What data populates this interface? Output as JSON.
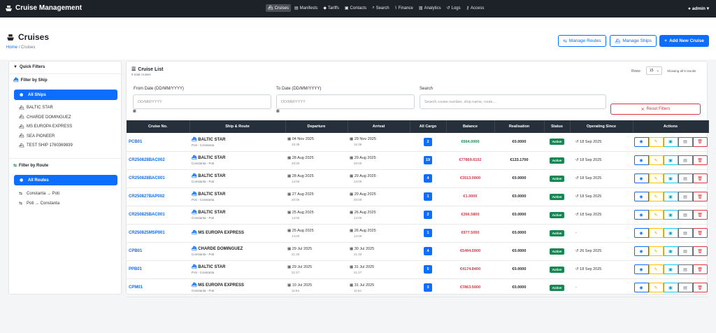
{
  "app": {
    "title": "Cruise Management",
    "user": "admin"
  },
  "nav": [
    {
      "label": "Cruises",
      "icon": "ship-icon",
      "active": true
    },
    {
      "label": "Manifests",
      "icon": "file-icon"
    },
    {
      "label": "Tariffs",
      "icon": "tags-icon"
    },
    {
      "label": "Contacts",
      "icon": "contacts-icon"
    },
    {
      "label": "Search",
      "icon": "search-icon"
    },
    {
      "label": "Finance",
      "icon": "chart-icon"
    },
    {
      "label": "Analytics",
      "icon": "bar-chart-icon"
    },
    {
      "label": "Logs",
      "icon": "history-icon"
    },
    {
      "label": "Access",
      "icon": "key-icon"
    }
  ],
  "page": {
    "title": "Cruises",
    "breadcrumb_home": "Home",
    "breadcrumb_sep": "/",
    "breadcrumb_current": "Cruises",
    "btn_routes": "Manage Routes",
    "btn_ships": "Manage Ships",
    "btn_new": "Add New Cruise"
  },
  "sidebar": {
    "title": "Quick Filters",
    "ship_title": "Filter by Ship",
    "ships": [
      "All Ships",
      "BALTIC STAR",
      "CHARDE DOMINGUEZ",
      "MS EUROPA EXPRESS",
      "SEA PIONEER",
      "TEST SHIP 1760369839"
    ],
    "route_title": "Filter by Route",
    "routes": [
      "All Routes",
      "Constanta → Poti",
      "Poti → Constanta"
    ]
  },
  "list": {
    "title": "Cruise List",
    "subtitle": "9 total cruises",
    "rows_label": "Rows:",
    "rows_value": "15",
    "showing": "Showing all 9 results",
    "from_label": "From Date (DD/MM/YYYY)",
    "from_placeholder": "DD/MM/YYYY",
    "to_label": "To Date (DD/MM/YYYY)",
    "to_placeholder": "DD/MM/YYYY",
    "search_label": "Search",
    "search_placeholder": "Search cruise number, ship name, route...",
    "reset": "Reset Filters",
    "columns": [
      "Cruise No.",
      "Ship & Route",
      "Departure",
      "Arrival",
      "All Cargo",
      "Balance",
      "Realisation",
      "Status",
      "Operating Since",
      "Actions"
    ],
    "rows": [
      {
        "no": "PCB01",
        "ship": "BALTIC STAR",
        "route": "Poti - Constanta",
        "dep_date": "04 Nov 2025",
        "dep_time": "15:38",
        "arr_date": "29 Nov 2025",
        "arr_time": "15:38",
        "cargo": "2",
        "balance": "€664.0000",
        "bal_pos": true,
        "realisation": "€0.0000",
        "status": "Active",
        "since": "18 Sep 2025"
      },
      {
        "no": "CR250828BAC002",
        "ship": "BALTIC STAR",
        "route": "Constanta - Poti",
        "dep_date": "28 Aug 2025",
        "dep_time": "20:00",
        "arr_date": "29 Aug 2025",
        "arr_time": "20:00",
        "cargo": "19",
        "balance": "€77869.6102",
        "bal_pos": false,
        "realisation": "€133.1700",
        "status": "Active",
        "since": "18 Sep 2025"
      },
      {
        "no": "CR250828BAC001",
        "ship": "BALTIC STAR",
        "route": "Constanta - Poti",
        "dep_date": "28 Aug 2025",
        "dep_time": "14:00",
        "arr_date": "29 Aug 2025",
        "arr_time": "14:00",
        "cargo": "4",
        "balance": "€3513.0000",
        "bal_pos": false,
        "realisation": "€0.0000",
        "status": "Active",
        "since": "18 Sep 2025"
      },
      {
        "no": "CR250827BAP002",
        "ship": "BALTIC STAR",
        "route": "Poti - Constanta",
        "dep_date": "27 Aug 2025",
        "dep_time": "20:00",
        "arr_date": "29 Aug 2025",
        "arr_time": "20:00",
        "cargo": "1",
        "balance": "€1.0000",
        "bal_pos": false,
        "realisation": "€0.0000",
        "status": "Active",
        "since": "18 Sep 2025"
      },
      {
        "no": "CR250825BAC001",
        "ship": "BALTIC STAR",
        "route": "Constanta - Poti",
        "dep_date": "25 Aug 2025",
        "dep_time": "14:00",
        "arr_date": "26 Aug 2025",
        "arr_time": "14:00",
        "cargo": "2",
        "balance": "€266.5800",
        "bal_pos": false,
        "realisation": "€0.0000",
        "status": "Active",
        "since": "18 Sep 2025"
      },
      {
        "no": "CR250825MSP001",
        "ship": "MS EUROPA EXPRESS",
        "route": "",
        "dep_date": "25 Aug 2025",
        "dep_time": "14:00",
        "arr_date": "26 Aug 2025",
        "arr_time": "14:00",
        "cargo": "1",
        "balance": "€977.5000",
        "bal_pos": false,
        "realisation": "€0.0000",
        "status": "Active",
        "since": "-"
      },
      {
        "no": "CPB01",
        "ship": "CHARDE DOMINGUEZ",
        "route": "Constanta - Poti",
        "dep_date": "29 Jul 2025",
        "dep_time": "21:33",
        "arr_date": "30 Jul 2025",
        "arr_time": "21:33",
        "cargo": "4",
        "balance": "€5494.5000",
        "bal_pos": false,
        "realisation": "€0.0000",
        "status": "Active",
        "since": "26 Sep 2025"
      },
      {
        "no": "PPB01",
        "ship": "BALTIC STAR",
        "route": "Poti - Constanta",
        "dep_date": "29 Jul 2025",
        "dep_time": "21:27",
        "arr_date": "31 Jul 2025",
        "arr_time": "21:27",
        "cargo": "5",
        "balance": "€4174.8400",
        "bal_pos": false,
        "realisation": "€0.0000",
        "status": "Active",
        "since": "18 Sep 2025"
      },
      {
        "no": "CPM01",
        "ship": "MS EUROPA EXPRESS",
        "route": "Constanta - Poti",
        "dep_date": "10 Jul 2025",
        "dep_time": "11:54",
        "arr_date": "31 Jul 2025",
        "arr_time": "11:54",
        "cargo": "3",
        "balance": "€7863.5000",
        "bal_pos": false,
        "realisation": "€0.0000",
        "status": "Active",
        "since": "-"
      }
    ]
  }
}
